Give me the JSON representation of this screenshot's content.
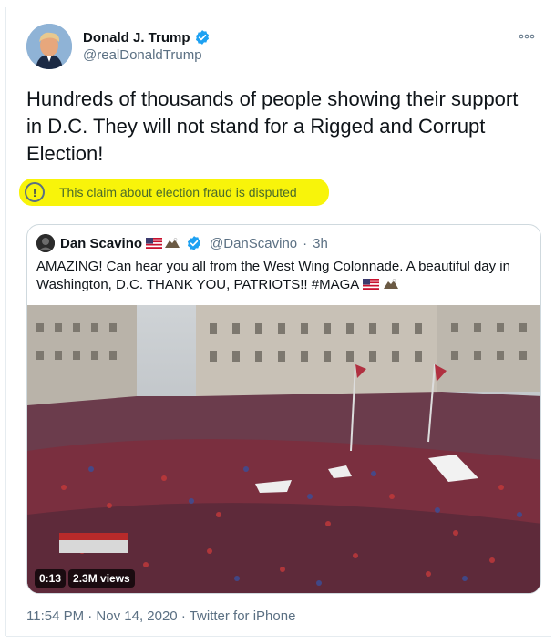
{
  "author": {
    "name": "Donald J. Trump",
    "handle": "@realDonaldTrump",
    "verified": true
  },
  "tweet": {
    "text": "Hundreds of thousands of people showing their support in D.C. They will not stand for a Rigged and Corrupt Election!"
  },
  "label": {
    "icon": "exclamation-icon",
    "text": "This claim about election fraud is disputed",
    "highlight_color": "#f8f40a"
  },
  "quoted": {
    "name": "Dan Scavino",
    "handle": "@DanScavino",
    "separator": "·",
    "time": "3h",
    "text": "AMAZING! Can hear you all from the West Wing Colonnade. A beautiful day in Washington, D.C. THANK YOU, PATRIOTS!! #MAGA",
    "video": {
      "duration": "0:13",
      "views": "2.3M views"
    }
  },
  "meta": {
    "text": "11:54 PM · Nov 14, 2020 · Twitter for iPhone"
  },
  "colors": {
    "accent": "#1da1f2",
    "secondary_text": "#5b7083"
  }
}
